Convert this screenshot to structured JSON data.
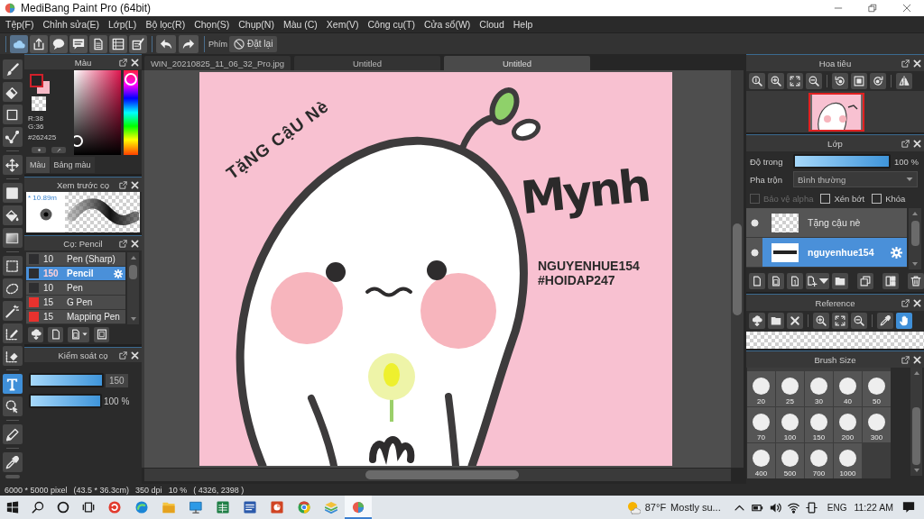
{
  "window": {
    "title": "MediBang Paint Pro (64bit)"
  },
  "menu": [
    "Tệp(F)",
    "Chỉnh sửa(E)",
    "Lớp(L)",
    "Bộ lọc(R)",
    "Chọn(S)",
    "Chụp(N)",
    "Màu (C)",
    "Xem(V)",
    "Công cụ(T)",
    "Cửa sổ(W)",
    "Cloud",
    "Help"
  ],
  "toolbar": {
    "buttons": [
      {
        "selected": true
      },
      {
        "selected": false
      },
      {
        "selected": false
      },
      {
        "selected": false
      },
      {
        "selected": false
      },
      {
        "selected": false
      },
      {
        "selected": false
      }
    ],
    "shortcut_label": "Phím",
    "reset_button": "Đặt lại"
  },
  "tools": [
    {
      "selected": false
    },
    {
      "selected": false
    },
    {
      "selected": false
    },
    {
      "selected": false
    },
    {
      "selected": false
    },
    {
      "selected": false
    },
    {
      "selected": false
    },
    {
      "selected": false
    },
    {
      "selected": false
    },
    {
      "selected": false
    },
    {
      "selected": false
    },
    {
      "selected": false
    },
    {
      "selected": false
    },
    {
      "selected": true
    },
    {
      "selected": false
    },
    {
      "selected": false
    },
    {
      "selected": false
    }
  ],
  "color_panel": {
    "title": "Màu",
    "red": "R:38",
    "green": "G:36",
    "hex": "#262425",
    "hue_slider": {
      "level": 0.98
    },
    "tabs": [
      {
        "label": "Màu",
        "selected": true
      },
      {
        "label": "Bảng màu",
        "selected": false
      }
    ]
  },
  "brush_preview": {
    "title": "Xem trước cọ",
    "size": "* 10.89m"
  },
  "brush_panel": {
    "title": "Cọ: Pencil",
    "brushes": [
      {
        "size": "10",
        "name": "Pen (Sharp)",
        "color": "#2e2e30",
        "selected": false
      },
      {
        "size": "150",
        "name": "Pencil",
        "color": "#2e2e30",
        "selected": true
      },
      {
        "size": "10",
        "name": "Pen",
        "color": "#2e2e30",
        "selected": false
      },
      {
        "size": "15",
        "name": "G Pen",
        "color": "#e8322e",
        "selected": false
      },
      {
        "size": "15",
        "name": "Mapping Pen",
        "color": "#e8322e",
        "selected": false
      }
    ]
  },
  "brush_control": {
    "title": "Kiểm soát cọ",
    "size": {
      "level": 1,
      "value": "150"
    },
    "opacity": {
      "level": 1,
      "value": "100 %"
    }
  },
  "canvas": {
    "tabs": [
      {
        "label": "WIN_20210825_11_06_32_Pro.jpg",
        "selected": false
      },
      {
        "label": "Untitled",
        "selected": false
      },
      {
        "label": "Untitled",
        "selected": true
      }
    ],
    "texts": [
      {
        "kind": "rotated",
        "text": "TặNG CậU Nè"
      },
      {
        "kind": "handwritten",
        "text": "Mynh"
      },
      {
        "kind": "caption",
        "text": "NGUYENHUE154"
      },
      {
        "kind": "caption",
        "text": "#HOIDAP247"
      }
    ]
  },
  "navigator": {
    "title": "Hoa tiêu"
  },
  "layers": {
    "title": "Lớp",
    "opacity_label": "Độ trong",
    "opacity": {
      "level": 1,
      "value": "100 %"
    },
    "blend_label": "Pha trộn",
    "blend_mode": "Bình thường",
    "options": [
      {
        "label": "Bảo vệ alpha",
        "checked": false,
        "disabled": true
      },
      {
        "label": "Xén bớt",
        "checked": false,
        "disabled": false
      },
      {
        "label": "Khóa",
        "checked": false,
        "disabled": false
      }
    ],
    "items": [
      {
        "name": "Tặng cậu nè",
        "visible": true,
        "selected": false
      },
      {
        "name": "nguyenhue154",
        "visible": true,
        "selected": true
      }
    ]
  },
  "reference": {
    "title": "Reference",
    "tools": [
      {
        "selected": false
      },
      {
        "selected": false
      },
      {
        "selected": false
      },
      {
        "selected": false
      },
      {
        "selected": false
      },
      {
        "selected": false
      },
      {
        "selected": false
      },
      {
        "selected": true
      }
    ]
  },
  "brush_size": {
    "title": "Brush Size",
    "sizes": [
      "20",
      "25",
      "30",
      "40",
      "50",
      "70",
      "100",
      "150",
      "200",
      "300",
      "400",
      "500",
      "700",
      "1000"
    ]
  },
  "status_bar": [
    "6000 * 5000 pixel",
    "(43.5 * 36.3cm)",
    "350 dpi",
    "10 %",
    "( 4326, 2398 )"
  ],
  "taskbar": {
    "apps": [
      {
        "selected": false
      },
      {
        "selected": false
      },
      {
        "selected": false
      },
      {
        "selected": false
      },
      {
        "selected": false
      },
      {
        "selected": false
      },
      {
        "selected": false
      },
      {
        "selected": false
      },
      {
        "selected": false
      },
      {
        "selected": true
      }
    ],
    "temperature": "87°F",
    "weather": "Mostly su...",
    "language": "ENG",
    "time": "11:22 AM"
  }
}
